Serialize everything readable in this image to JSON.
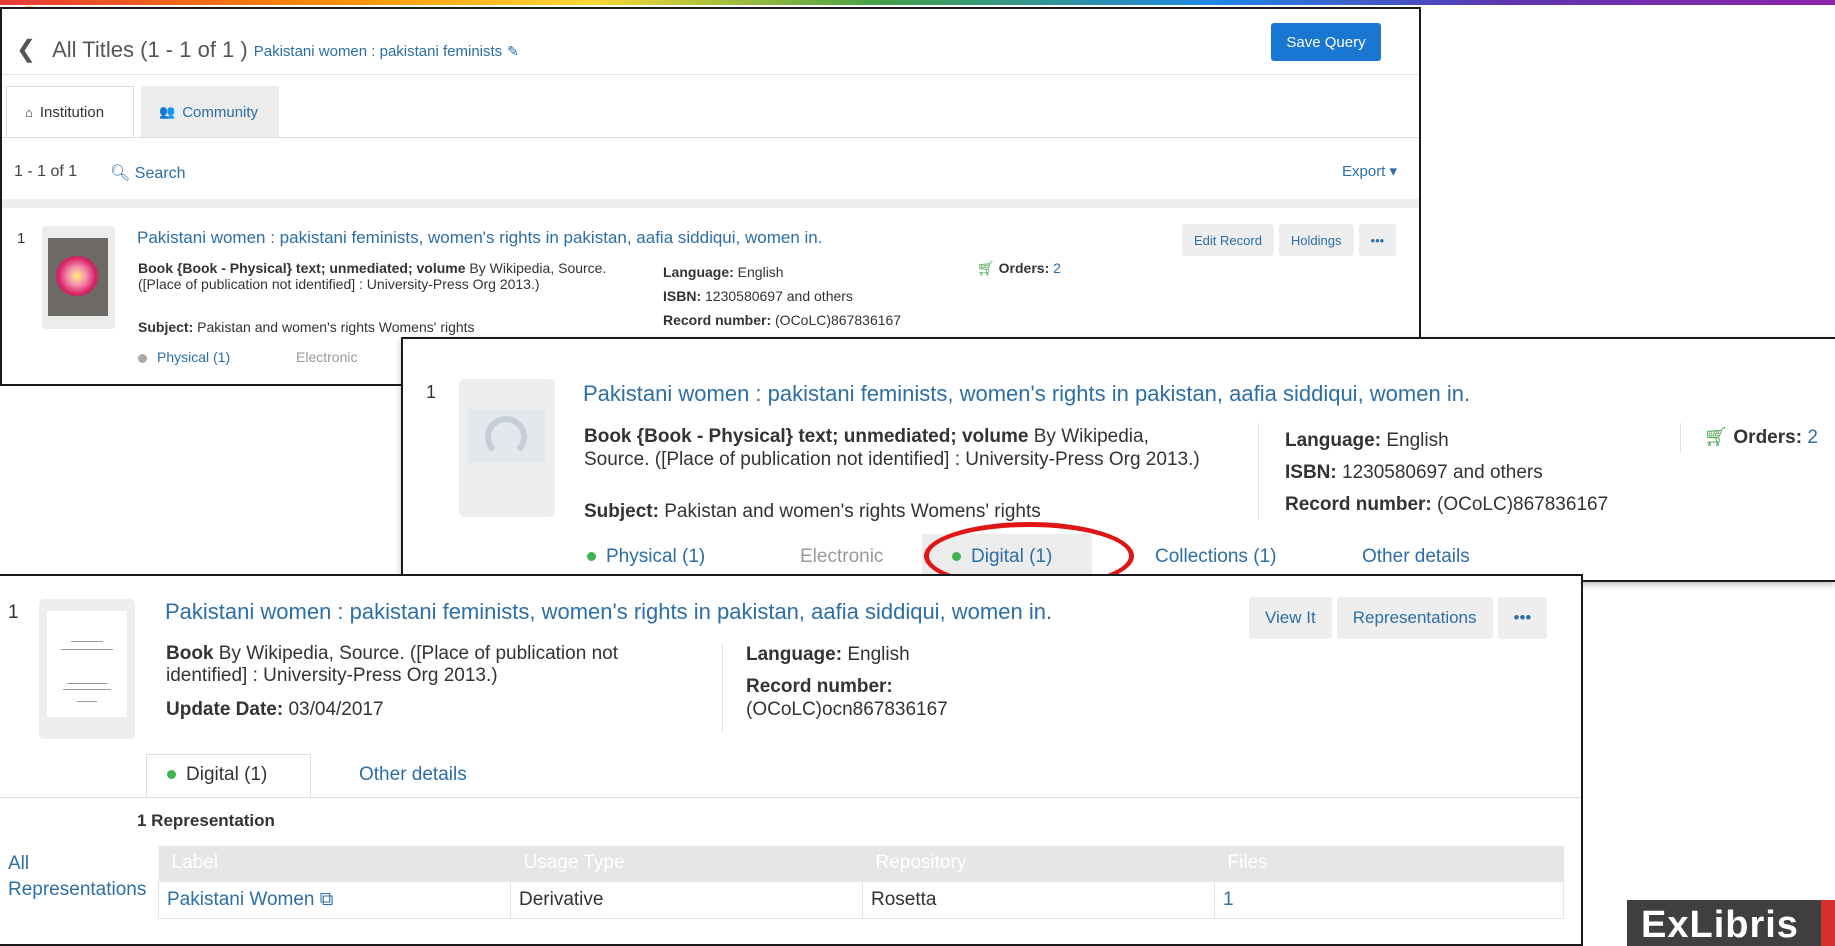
{
  "panel1": {
    "header": {
      "title": "All Titles (1 - 1 of 1 )",
      "query": "Pakistani women : pakistani feminists"
    },
    "save_query": "Save Query",
    "tabs": {
      "institution": "Institution",
      "community": "Community"
    },
    "count": "1 - 1 of 1",
    "search": "Search",
    "export": "Export",
    "result": {
      "number": "1",
      "title": "Pakistani women : pakistani feminists, women's rights in pakistan, aafia siddiqui, women in.",
      "desc_bold": "Book {Book - Physical} text; unmediated; volume",
      "desc_rest": " By Wikipedia, Source. ([Place of publication not identified] : University-Press Org 2013.)",
      "subject_label": "Subject:",
      "subject": " Pakistan and women's rights Womens' rights",
      "language_label": "Language:",
      "language": " English",
      "isbn_label": "ISBN:",
      "isbn": " 1230580697 and others",
      "record_label": "Record number:",
      "record": " (OCoLC)867836167",
      "orders_label": "Orders:",
      "orders": "2",
      "buttons": {
        "edit": "Edit Record",
        "holdings": "Holdings",
        "more": "•••"
      },
      "physical": "Physical (1)",
      "electronic": "Electronic"
    }
  },
  "panel2": {
    "number": "1",
    "title": "Pakistani women : pakistani feminists, women's rights in pakistan, aafia siddiqui, women in.",
    "desc_bold": "Book {Book - Physical} text; unmediated; volume",
    "desc_rest": " By Wikipedia, Source. ([Place of publication not identified] : University-Press Org 2013.)",
    "subject_label": "Subject:",
    "subject": " Pakistan and women's rights Womens' rights",
    "language_label": "Language:",
    "language": " English",
    "isbn_label": "ISBN:",
    "isbn": " 1230580697 and others",
    "record_label": "Record number:",
    "record": " (OCoLC)867836167",
    "orders_label": "Orders:",
    "orders": "2",
    "tabs": {
      "physical": "Physical (1)",
      "electronic": "Electronic",
      "digital": "Digital (1)",
      "collections": "Collections (1)",
      "other": "Other details"
    }
  },
  "panel3": {
    "number": "1",
    "title": "Pakistani women : pakistani feminists, women's rights in pakistan, aafia siddiqui, women in.",
    "desc_bold": "Book",
    "desc_rest": " By Wikipedia, Source. ([Place of publication not identified] : University-Press Org 2013.)",
    "update_label": "Update Date:",
    "update": " 03/04/2017",
    "language_label": "Language:",
    "language": " English",
    "record_label": "Record number:",
    "record": "(OCoLC)ocn867836167",
    "buttons": {
      "view": "View It",
      "representations": "Representations",
      "more": "•••"
    },
    "tabs": {
      "digital": "Digital (1)",
      "other": "Other details"
    },
    "rep_title": "1 Representation",
    "all_reps": "All Representations",
    "table": {
      "headers": [
        "Label",
        "Usage Type",
        "Repository",
        "Files"
      ],
      "row": {
        "label": "Pakistani Women",
        "usage": "Derivative",
        "repository": "Rosetta",
        "files": "1"
      }
    }
  },
  "logo": {
    "text": "ExLibris"
  },
  "colors": {
    "link": "#2c6ea5",
    "primary_button": "#1976d2",
    "status_green": "#3fb34f",
    "highlight_ring": "#e01616"
  }
}
